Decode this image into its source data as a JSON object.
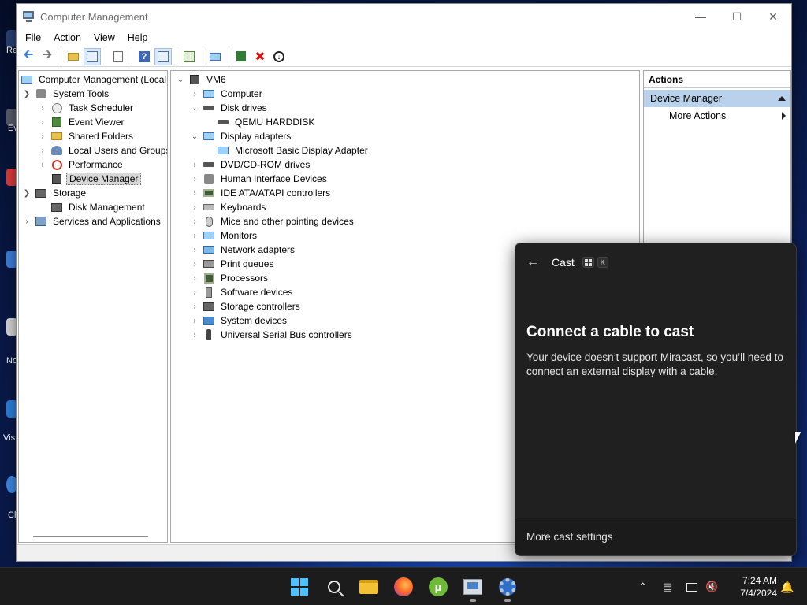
{
  "desktop": {
    "fragments": [
      "Re",
      "Ev",
      "No",
      "Vis",
      "Ch"
    ]
  },
  "window": {
    "title": "Computer Management",
    "menu": [
      "File",
      "Action",
      "View",
      "Help"
    ]
  },
  "left_tree": {
    "root": "Computer Management (Local",
    "items": [
      {
        "label": "System Tools",
        "level": 1,
        "expanded": true
      },
      {
        "label": "Task Scheduler",
        "level": 2
      },
      {
        "label": "Event Viewer",
        "level": 2
      },
      {
        "label": "Shared Folders",
        "level": 2
      },
      {
        "label": "Local Users and Groups",
        "level": 2
      },
      {
        "label": "Performance",
        "level": 2
      },
      {
        "label": "Device Manager",
        "level": 2,
        "selected": true
      },
      {
        "label": "Storage",
        "level": 1,
        "expanded": true
      },
      {
        "label": "Disk Management",
        "level": 2
      },
      {
        "label": "Services and Applications",
        "level": 1
      }
    ]
  },
  "device_tree": {
    "root": "VM6",
    "items": [
      {
        "label": "Computer",
        "icon": "computer-icon"
      },
      {
        "label": "Disk drives",
        "icon": "disk-drive-icon",
        "expanded": true,
        "children": [
          "QEMU HARDDISK"
        ]
      },
      {
        "label": "Display adapters",
        "icon": "display-adapter-icon",
        "expanded": true,
        "children": [
          "Microsoft Basic Display Adapter"
        ]
      },
      {
        "label": "DVD/CD-ROM drives",
        "icon": "dvd-drive-icon"
      },
      {
        "label": "Human Interface Devices",
        "icon": "hid-icon"
      },
      {
        "label": "IDE ATA/ATAPI controllers",
        "icon": "ide-controller-icon"
      },
      {
        "label": "Keyboards",
        "icon": "keyboard-icon"
      },
      {
        "label": "Mice and other pointing devices",
        "icon": "mouse-icon"
      },
      {
        "label": "Monitors",
        "icon": "monitor-icon"
      },
      {
        "label": "Network adapters",
        "icon": "network-adapter-icon"
      },
      {
        "label": "Print queues",
        "icon": "printer-icon"
      },
      {
        "label": "Processors",
        "icon": "processor-icon"
      },
      {
        "label": "Software devices",
        "icon": "software-device-icon"
      },
      {
        "label": "Storage controllers",
        "icon": "storage-controller-icon"
      },
      {
        "label": "System devices",
        "icon": "system-device-icon"
      },
      {
        "label": "Universal Serial Bus controllers",
        "icon": "usb-icon"
      }
    ]
  },
  "actions": {
    "title": "Actions",
    "section": "Device Manager",
    "item": "More Actions"
  },
  "cast": {
    "title": "Cast",
    "shortcut_key": "K",
    "heading": "Connect a cable to cast",
    "body": "Your device doesn’t support Miracast, so you’ll need to connect an external display with a cable.",
    "footer": "More cast settings"
  },
  "taskbar": {
    "time": "7:24 AM",
    "date": "7/4/2024"
  },
  "colors": {
    "selection": "#d9d9d9",
    "actions_highlight": "#b9d1ea",
    "cast_bg": "#202020",
    "taskbar_bg": "#1c1c1c",
    "start_blue": "#4cc2ff"
  }
}
